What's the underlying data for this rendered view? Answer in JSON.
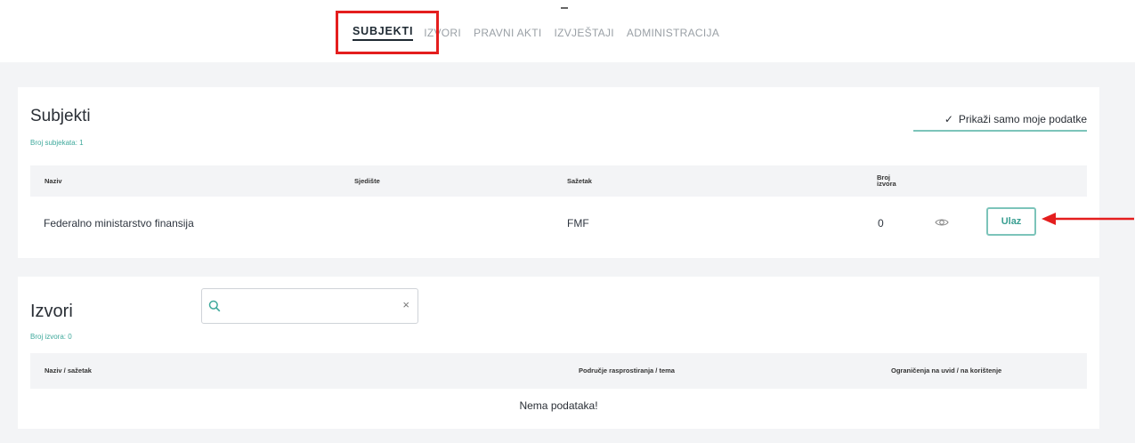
{
  "nav": {
    "items": [
      "SUBJEKTI",
      "IZVORI",
      "PRAVNI AKTI",
      "IZVJEŠTAJI",
      "ADMINISTRACIJA"
    ]
  },
  "subjekti": {
    "title": "Subjekti",
    "count": "Broj subjekata: 1",
    "filter_label": "Prikaži samo moje podatke",
    "filter_checked": true,
    "columns": [
      "Naziv",
      "Sjedište",
      "Sažetak",
      "Broj izvora"
    ],
    "rows": [
      {
        "naziv": "Federalno ministarstvo finansija",
        "sjediste": "",
        "sazetak": "FMF",
        "broj_izvora": "0",
        "action_label": "Ulaz"
      }
    ]
  },
  "izvori": {
    "title": "Izvori",
    "count": "Broj izvora: 0",
    "search_placeholder": "",
    "columns": [
      "Naziv / sažetak",
      "Područje rasprostiranja / tema",
      "Ograničenja na uvid / na korištenje"
    ],
    "empty_message": "Nema podataka!"
  },
  "colors": {
    "accent": "#3fa99c",
    "highlight": "#e41e1e"
  },
  "icons": {
    "view": "eye-icon",
    "search": "search-icon",
    "clear": "close-icon",
    "check": "check-icon"
  }
}
